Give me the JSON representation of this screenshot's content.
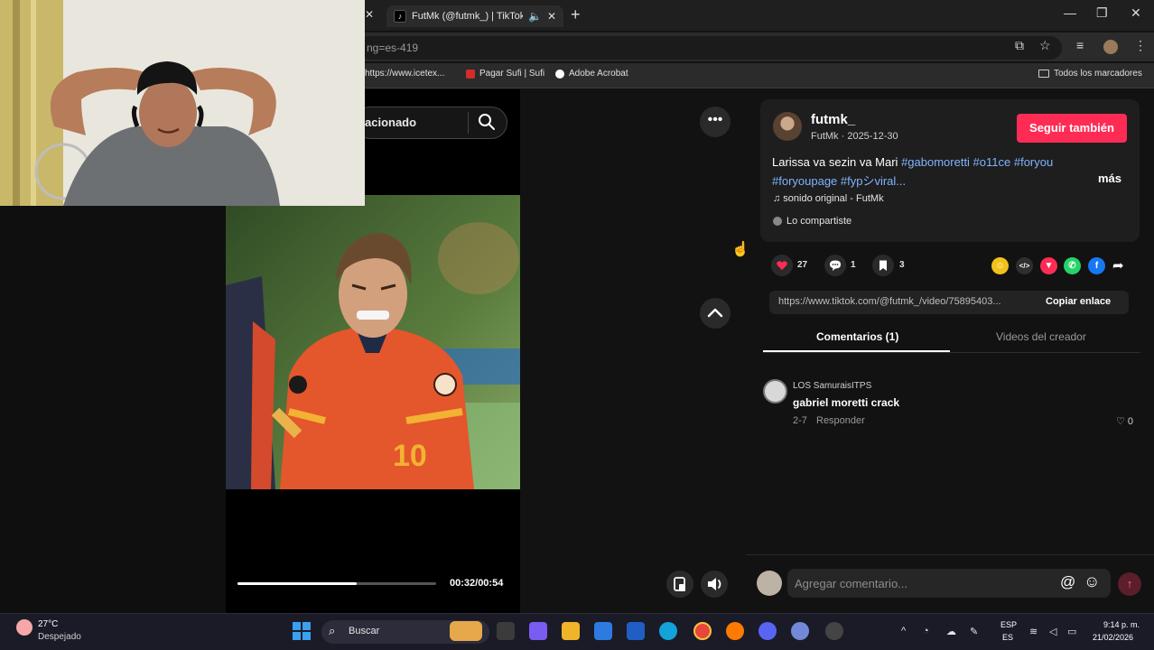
{
  "browser": {
    "tab_title": "FutMk (@futmk_) | TikTok",
    "url_fragment": "ng=es-419",
    "bookmarks": [
      {
        "label": "https://www.icetex...",
        "color": "#e85d5d"
      },
      {
        "label": "Pagar Sufi | Sufi",
        "color": "#d62b2b"
      },
      {
        "label": "Adobe Acrobat",
        "color": "#ffffff"
      }
    ],
    "bookmarks_all": "Todos los marcadores",
    "icons": [
      "close-icon",
      "mute-icon",
      "plus-icon",
      "minimize-icon",
      "maximize-icon",
      "star-icon",
      "download-icon",
      "extensions-icon",
      "profile-icon",
      "menu-icon",
      "folder-icon"
    ]
  },
  "search": {
    "text": "acionado"
  },
  "video": {
    "time": "00:32/00:54",
    "progress": 0.6
  },
  "post": {
    "username": "futmk_",
    "meta": "FutMk · 2025-12-30",
    "follow_label": "Seguir también",
    "description_plain": "Larissa va sezin va Mari ",
    "tags_line1": "#gabomoretti #o11ce #foryou",
    "tags_line2": "#foryoupage #fypシviral...",
    "more_label": "más",
    "sound": "♫  sonido original - FutMk",
    "shared": "Lo compartiste",
    "likes": "27",
    "comments": "1",
    "saves": "3",
    "share_colors": [
      "#f2c21c",
      "#2f2f2f",
      "#fe2c55",
      "#25d366",
      "#1877f2"
    ],
    "link": "https://www.tiktok.com/@futmk_/video/75895403...",
    "copy_label": "Copiar enlace"
  },
  "tabs": {
    "comments": "Comentarios (1)",
    "creator": "Videos del creador"
  },
  "comment": {
    "author": "LOS SamuraisITPS",
    "text": "gabriel moretti crack",
    "date": "2-7",
    "reply": "Responder",
    "likes": "♡ 0"
  },
  "compose": {
    "placeholder": "Agregar comentario..."
  },
  "taskbar": {
    "temp": "27°C",
    "weather": "Despejado",
    "search": "Buscar",
    "lang1": "ESP",
    "lang2": "ES",
    "time": "9:14 p. m.",
    "date": "21/02/2026",
    "app_colors": [
      "#3b3b3b",
      "#7a5cf0",
      "#f0b429",
      "#2d7be0",
      "#1f5fc4",
      "#12a3d8",
      "#e8453c",
      "#ff7a00",
      "#5865f2",
      "#7289da",
      "#444444"
    ]
  }
}
